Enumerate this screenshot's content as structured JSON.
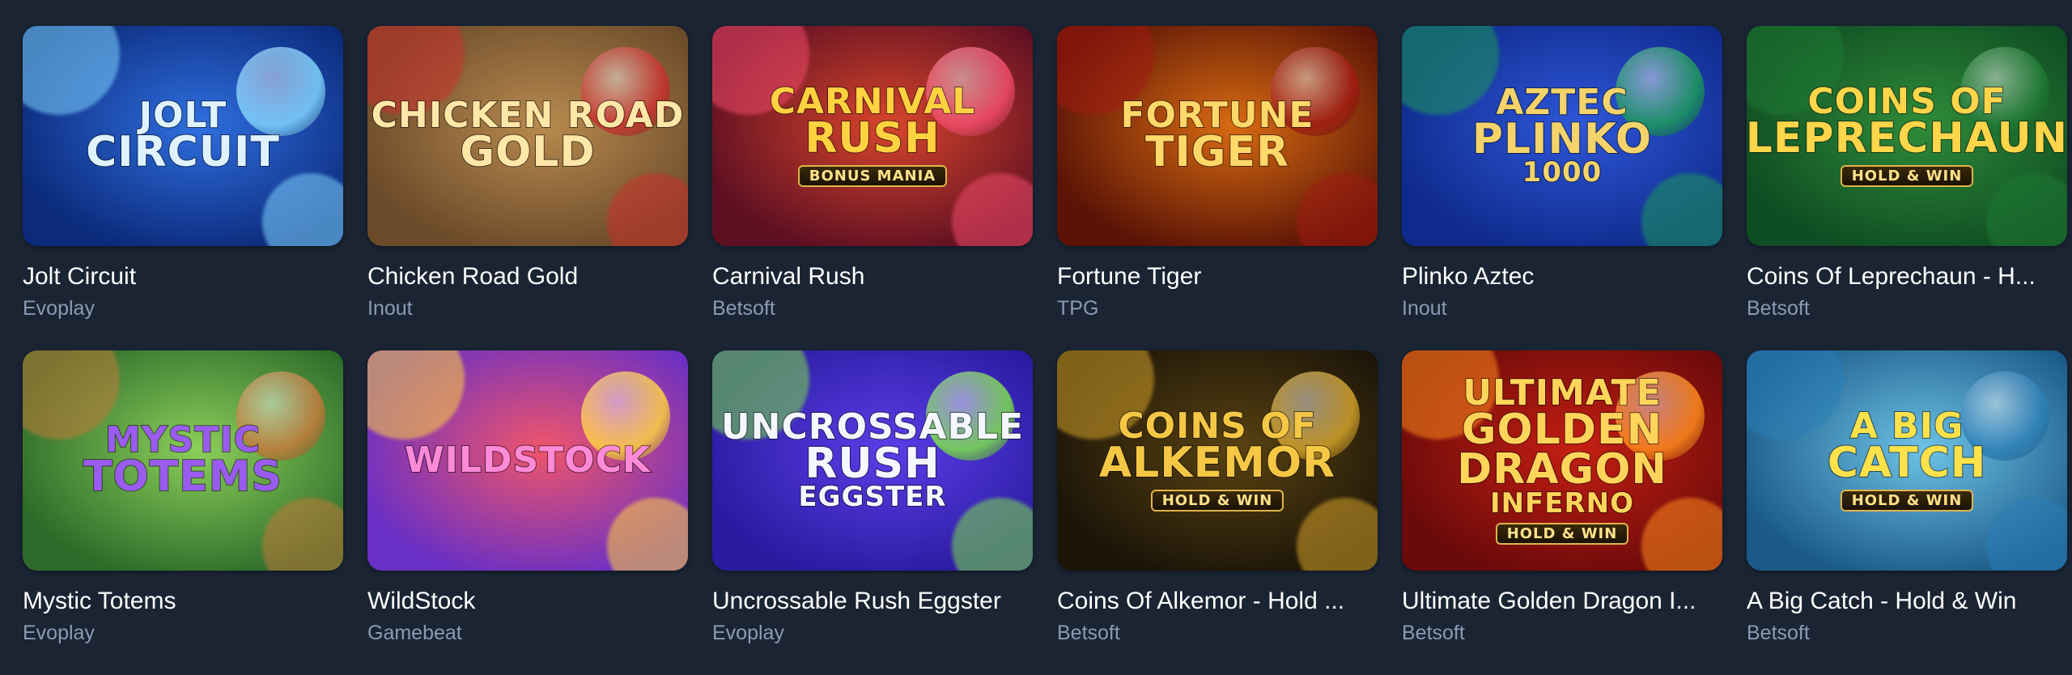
{
  "games": [
    {
      "title": "Jolt Circuit",
      "provider": "Evoplay",
      "logo_lines": [
        "Jolt",
        "Circuit",
        ""
      ],
      "badge": "",
      "bg": [
        "#0b2a7a",
        "#2f6fe0"
      ],
      "logo_color": "#dff3ff",
      "accent": "#7fd3ff"
    },
    {
      "title": "Chicken Road Gold",
      "provider": "Inout",
      "logo_lines": [
        "Chicken Road",
        "Gold",
        ""
      ],
      "badge": "",
      "bg": [
        "#6b4a2a",
        "#b88a4e"
      ],
      "logo_color": "#ffe7a8",
      "accent": "#c9302c"
    },
    {
      "title": "Carnival Rush",
      "provider": "Betsoft",
      "logo_lines": [
        "Carnival",
        "Rush",
        ""
      ],
      "badge": "Bonus Mania",
      "bg": [
        "#5e0f22",
        "#d8452c"
      ],
      "logo_color": "#ffd23f",
      "accent": "#f24b6a"
    },
    {
      "title": "Fortune Tiger",
      "provider": "TPG",
      "logo_lines": [
        "Fortune",
        "Tiger",
        ""
      ],
      "badge": "",
      "bg": [
        "#5a1306",
        "#d86b12"
      ],
      "logo_color": "#ffd86a",
      "accent": "#a01b12"
    },
    {
      "title": "Plinko Aztec",
      "provider": "Inout",
      "logo_lines": [
        "Aztec",
        "Plinko",
        "1000"
      ],
      "badge": "",
      "bg": [
        "#0f2a8c",
        "#2e57d9"
      ],
      "logo_color": "#f3d36a",
      "accent": "#1c9a5a"
    },
    {
      "title": "Coins Of Leprechaun - H...",
      "provider": "Betsoft",
      "logo_lines": [
        "Coins of",
        "Leprechaun",
        ""
      ],
      "badge": "Hold & Win",
      "bg": [
        "#0f4d22",
        "#2f8c3a"
      ],
      "logo_color": "#ffd54a",
      "accent": "#1f7a34"
    },
    {
      "title": "Mystic Totems",
      "provider": "Evoplay",
      "logo_lines": [
        "Mystic",
        "Totems",
        ""
      ],
      "badge": "",
      "bg": [
        "#2d6b2a",
        "#8ccf5a"
      ],
      "logo_color": "#9a5cf0",
      "accent": "#c47a3a"
    },
    {
      "title": "WildStock",
      "provider": "Gamebeat",
      "logo_lines": [
        "WildStock",
        "",
        ""
      ],
      "badge": "",
      "bg": [
        "#6a2fc4",
        "#f0556a"
      ],
      "logo_color": "#ff8ad8",
      "accent": "#ffd23f"
    },
    {
      "title": "Uncrossable Rush Eggster",
      "provider": "Evoplay",
      "logo_lines": [
        "Uncrossable",
        "Rush",
        "Eggster"
      ],
      "badge": "",
      "bg": [
        "#2a1aa0",
        "#5b3ee8"
      ],
      "logo_color": "#f4f7ff",
      "accent": "#7be04a"
    },
    {
      "title": "Coins Of Alkemor - Hold ...",
      "provider": "Betsoft",
      "logo_lines": [
        "Coins of",
        "Alkemor",
        ""
      ],
      "badge": "Hold & Win",
      "bg": [
        "#1b1408",
        "#5a4312"
      ],
      "logo_color": "#f5c744",
      "accent": "#d4a22a"
    },
    {
      "title": "Ultimate Golden Dragon I...",
      "provider": "Betsoft",
      "logo_lines": [
        "Ultimate",
        "Golden Dragon",
        "Inferno"
      ],
      "badge": "Hold & Win",
      "bg": [
        "#6a0a0a",
        "#c51f12"
      ],
      "logo_color": "#ffd45a",
      "accent": "#ff8a1c"
    },
    {
      "title": "A Big Catch - Hold & Win",
      "provider": "Betsoft",
      "logo_lines": [
        "A Big",
        "Catch",
        ""
      ],
      "badge": "Hold & Win",
      "bg": [
        "#1b5a88",
        "#6ec3e6"
      ],
      "logo_color": "#ffe24a",
      "accent": "#2b7fb8"
    }
  ]
}
